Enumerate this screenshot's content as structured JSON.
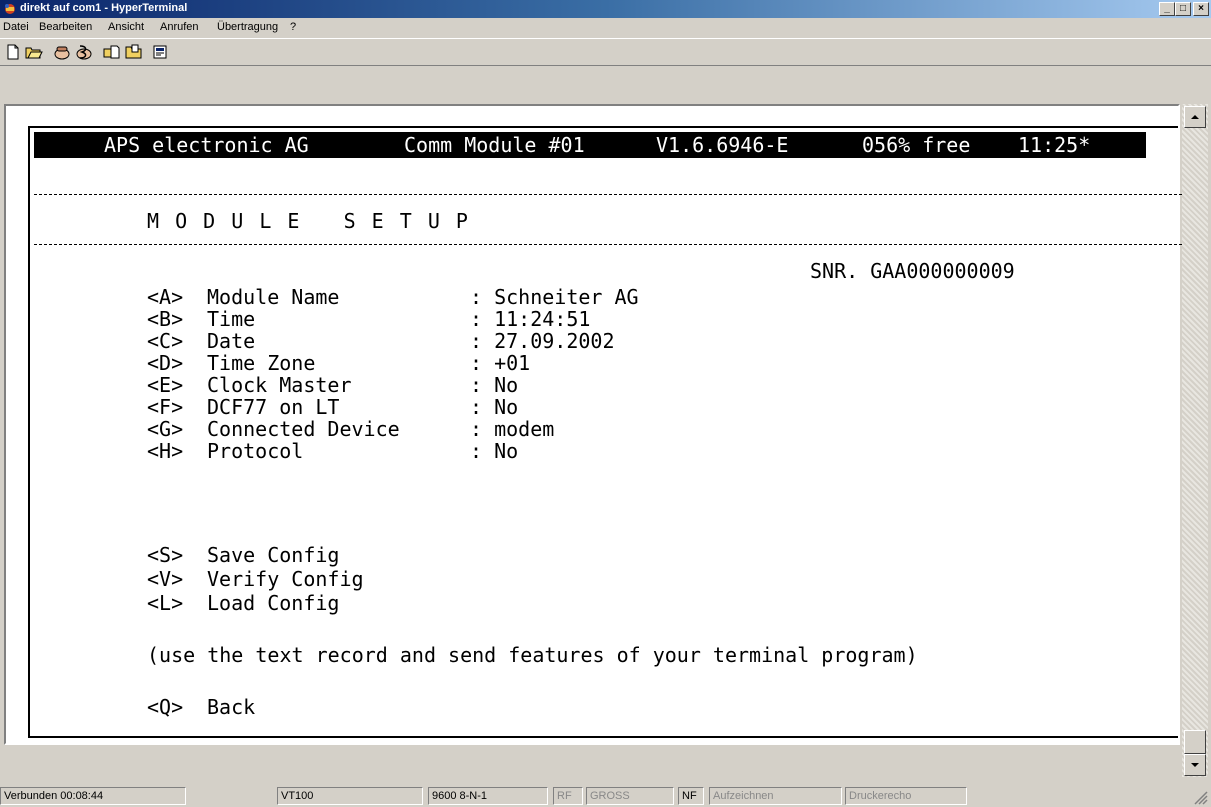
{
  "window": {
    "title": "direkt auf com1 - HyperTerminal",
    "minimize_label": "_",
    "maximize_label": "□",
    "close_label": "×"
  },
  "menu": [
    {
      "label": "Datei"
    },
    {
      "label": "Bearbeiten"
    },
    {
      "label": "Ansicht"
    },
    {
      "label": "Anrufen"
    },
    {
      "label": "Übertragung"
    },
    {
      "label": "?"
    }
  ],
  "toolbar": {
    "buttons": [
      "new-icon",
      "open-icon",
      "connect-icon",
      "disconnect-icon",
      "send-icon",
      "receive-icon",
      "properties-icon"
    ]
  },
  "terminal": {
    "header": {
      "company": "APS electronic AG",
      "module": "Comm Module #01",
      "version": "V1.6.6946-E",
      "free": "056% free",
      "time": "11:25*"
    },
    "section_title": "M O D U L E   S E T U P",
    "serial": "SNR. GAA000000009",
    "settings": [
      {
        "key": "<A>",
        "label": "Module Name",
        "value": ": Schneiter AG"
      },
      {
        "key": "<B>",
        "label": "Time",
        "value": ": 11:24:51"
      },
      {
        "key": "<C>",
        "label": "Date",
        "value": ": 27.09.2002"
      },
      {
        "key": "<D>",
        "label": "Time Zone",
        "value": ": +01"
      },
      {
        "key": "<E>",
        "label": "Clock Master",
        "value": ": No"
      },
      {
        "key": "<F>",
        "label": "DCF77 on LT",
        "value": ": No"
      },
      {
        "key": "<G>",
        "label": "Connected Device",
        "value": ": modem"
      },
      {
        "key": "<H>",
        "label": "Protocol",
        "value": ": No"
      }
    ],
    "actions": [
      {
        "key": "<S>",
        "label": "Save Config"
      },
      {
        "key": "<V>",
        "label": "Verify Config"
      },
      {
        "key": "<L>",
        "label": "Load Config"
      }
    ],
    "note": "(use the text record and send features of your terminal program)",
    "back": {
      "key": "<Q>",
      "label": "Back"
    }
  },
  "statusbar": {
    "connected": "Verbunden 00:08:44",
    "emulation": "VT100",
    "port": "9600 8-N-1",
    "rf": "RF",
    "gross": "GROSS",
    "nf": "NF",
    "record": "Aufzeichnen",
    "print_echo": "Druckerecho"
  }
}
